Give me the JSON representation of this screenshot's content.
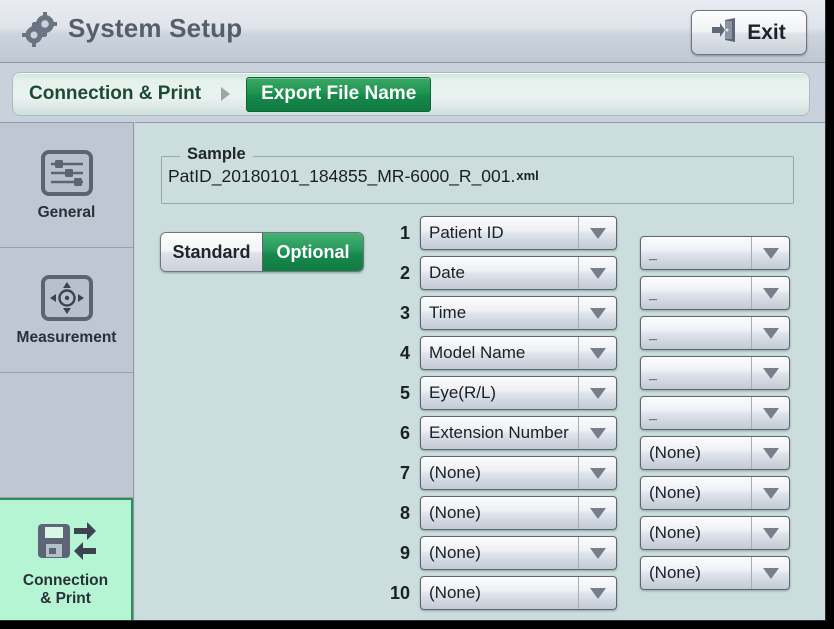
{
  "window": {
    "title": "System Setup",
    "title_icon": "gears-icon"
  },
  "titlebar": {
    "exit_label": "Exit",
    "exit_icon": "exit-door-icon"
  },
  "breadcrumb": {
    "root_label": "Connection & Print",
    "separator_icon": "chevron-right-icon",
    "active_label": "Export File Name"
  },
  "sidebar": {
    "items": [
      {
        "label": "General",
        "icon": "sliders-icon",
        "selected": false
      },
      {
        "label": "Measurement",
        "icon": "crosshair-move-icon",
        "selected": false
      },
      {
        "label": "",
        "icon": "",
        "selected": false
      },
      {
        "label": "Connection\n& Print",
        "icon": "floppy-transfer-icon",
        "selected": true
      }
    ],
    "item_connection_line1": "Connection",
    "item_connection_line2": "& Print"
  },
  "main": {
    "sample": {
      "legend": "Sample",
      "value": "PatID_20180101_184855_MR-6000_R_001.",
      "extension": "xml"
    },
    "mode_toggle": {
      "standard_label": "Standard",
      "optional_label": "Optional",
      "selected": "Optional"
    },
    "field_rows": [
      {
        "num": "1",
        "value": "Patient ID"
      },
      {
        "num": "2",
        "value": "Date"
      },
      {
        "num": "3",
        "value": "Time"
      },
      {
        "num": "4",
        "value": "Model Name"
      },
      {
        "num": "5",
        "value": "Eye(R/L)"
      },
      {
        "num": "6",
        "value": "Extension Number"
      },
      {
        "num": "7",
        "value": "(None)"
      },
      {
        "num": "8",
        "value": "(None)"
      },
      {
        "num": "9",
        "value": "(None)"
      },
      {
        "num": "10",
        "value": "(None)"
      }
    ],
    "separator_rows": [
      {
        "value": "_"
      },
      {
        "value": "_"
      },
      {
        "value": "_"
      },
      {
        "value": "_"
      },
      {
        "value": "_"
      },
      {
        "value": "(None)"
      },
      {
        "value": "(None)"
      },
      {
        "value": "(None)"
      },
      {
        "value": "(None)"
      }
    ]
  },
  "colors": {
    "accent_green": "#17884a",
    "selected_sidebar": "#b5f5d4",
    "content_bg": "#cbdedd",
    "sidebar_bg": "#c0c7d4"
  }
}
